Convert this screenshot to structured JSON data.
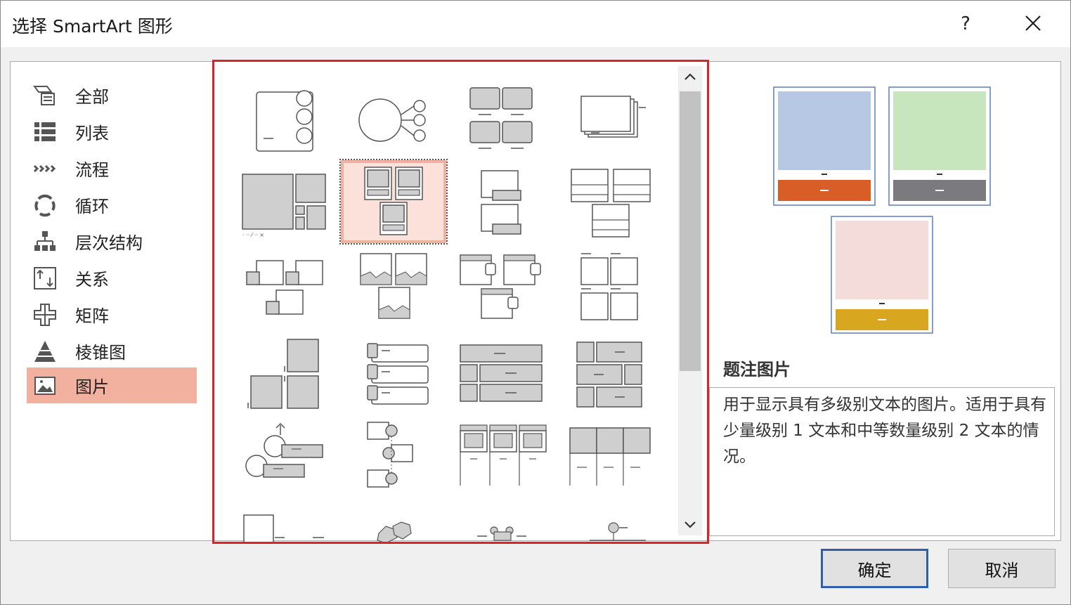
{
  "dialog": {
    "title": "选择 SmartArt 图形",
    "help_label": "?",
    "close_icon": "close-icon"
  },
  "categories": [
    {
      "label": "全部",
      "icon": "all-icon"
    },
    {
      "label": "列表",
      "icon": "list-icon"
    },
    {
      "label": "流程",
      "icon": "process-icon"
    },
    {
      "label": "循环",
      "icon": "cycle-icon"
    },
    {
      "label": "层次结构",
      "icon": "hierarchy-icon"
    },
    {
      "label": "关系",
      "icon": "relationship-icon"
    },
    {
      "label": "矩阵",
      "icon": "matrix-icon"
    },
    {
      "label": "棱锥图",
      "icon": "pyramid-icon"
    },
    {
      "label": "图片",
      "icon": "picture-icon",
      "selected": true
    }
  ],
  "gallery": {
    "selected_index": 5,
    "layout_count_visible": 24
  },
  "preview": {
    "colors": {
      "blue": "#b7c8e4",
      "green": "#c8e6bd",
      "pink": "#f4dcdb",
      "orange_bar": "#d85d26",
      "gray_bar": "#7b7b7f",
      "gold_bar": "#d9a61f"
    },
    "title": "题注图片",
    "description": "用于显示具有多级别文本的图片。适用于具有少量级别 1 文本和中等数量级别 2 文本的情况。"
  },
  "buttons": {
    "ok": "确定",
    "cancel": "取消"
  },
  "colors": {
    "selection": "#f2b19f",
    "gallery_border": "#d9252a",
    "primary_border": "#2f5fa8"
  }
}
